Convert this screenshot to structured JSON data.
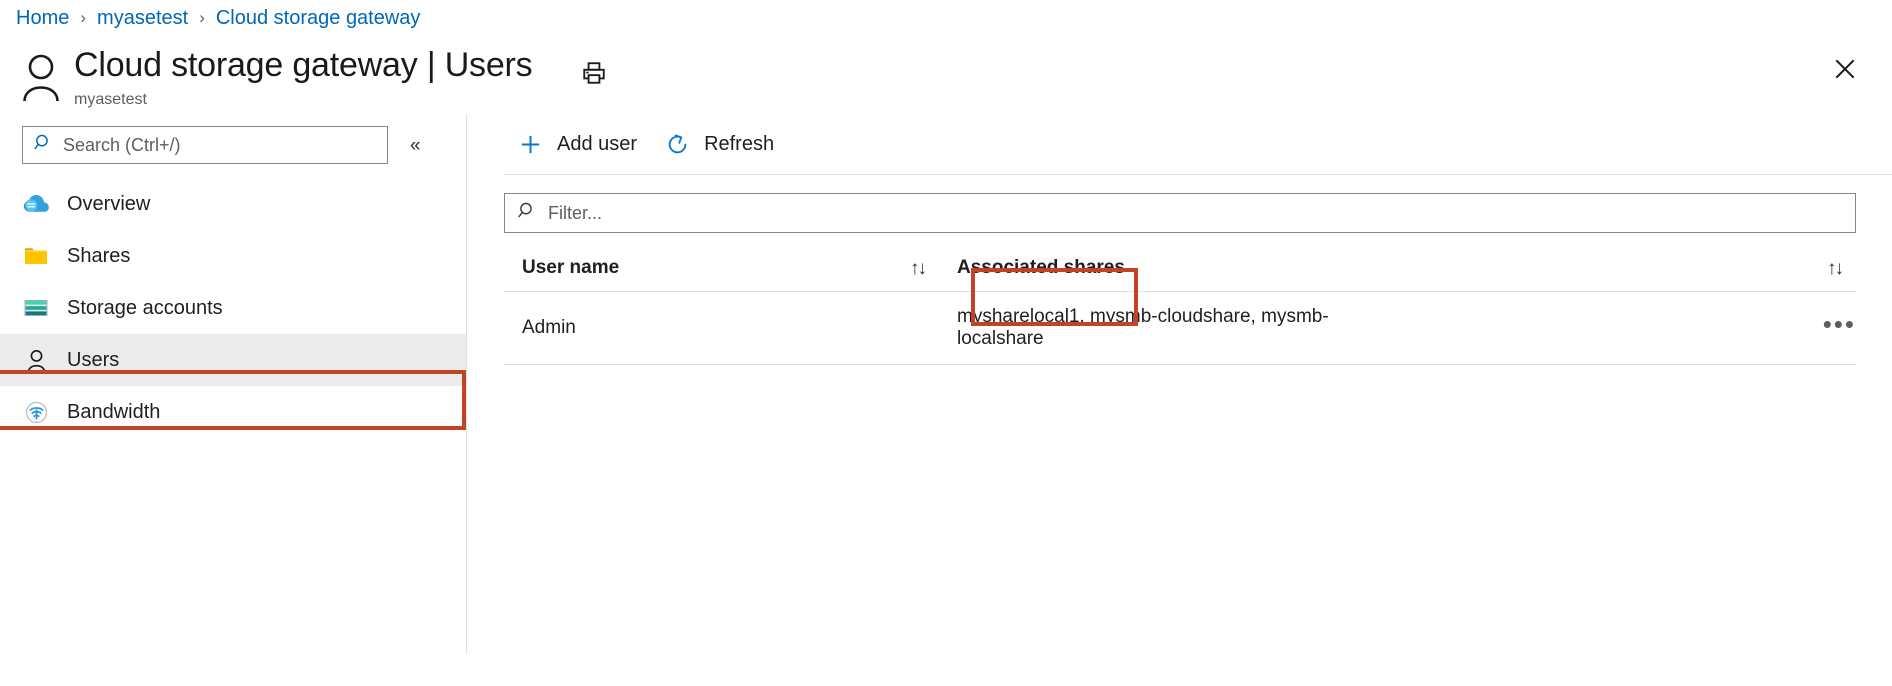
{
  "breadcrumb": {
    "items": [
      "Home",
      "myasetest",
      "Cloud storage gateway"
    ],
    "separator": "›"
  },
  "header": {
    "title": "Cloud storage gateway | Users",
    "subtitle": "myasetest",
    "avatar_icon": "user-icon",
    "print_icon": "print-icon",
    "close_icon": "close-icon"
  },
  "sidebar": {
    "search": {
      "placeholder": "Search (Ctrl+/)",
      "value": "",
      "icon": "search-icon"
    },
    "collapse_label": "«",
    "items": [
      {
        "label": "Overview",
        "icon": "cloud-icon",
        "selected": false
      },
      {
        "label": "Shares",
        "icon": "folder-icon",
        "selected": false
      },
      {
        "label": "Storage accounts",
        "icon": "storage-account-icon",
        "selected": false
      },
      {
        "label": "Users",
        "icon": "user-icon",
        "selected": true
      },
      {
        "label": "Bandwidth",
        "icon": "bandwidth-icon",
        "selected": false
      }
    ]
  },
  "toolbar": {
    "add_user_label": "Add user",
    "add_user_icon": "plus-icon",
    "refresh_label": "Refresh",
    "refresh_icon": "refresh-icon"
  },
  "filter": {
    "placeholder": "Filter...",
    "value": "",
    "icon": "search-icon"
  },
  "table": {
    "columns": [
      {
        "label": "User name",
        "sort_icon": "sort-updown-icon"
      },
      {
        "label": "Associated shares",
        "sort_icon": "sort-updown-icon"
      }
    ],
    "rows": [
      {
        "user_name": "Admin",
        "associated_shares": "mysharelocal1, mysmb-cloudshare, mysmb-localshare",
        "actions_icon": "ellipsis-icon"
      }
    ],
    "sort_glyph": "↑↓",
    "ellipsis_glyph": "•••"
  },
  "annotations": {
    "highlight_color": "#c0432a",
    "boxes": [
      "sidebar-item-users",
      "add-user-button"
    ]
  },
  "colors": {
    "link": "#0067b8",
    "accent": "#0078d4",
    "selected_bg": "#edebe9",
    "border": "#e1dfdd"
  }
}
